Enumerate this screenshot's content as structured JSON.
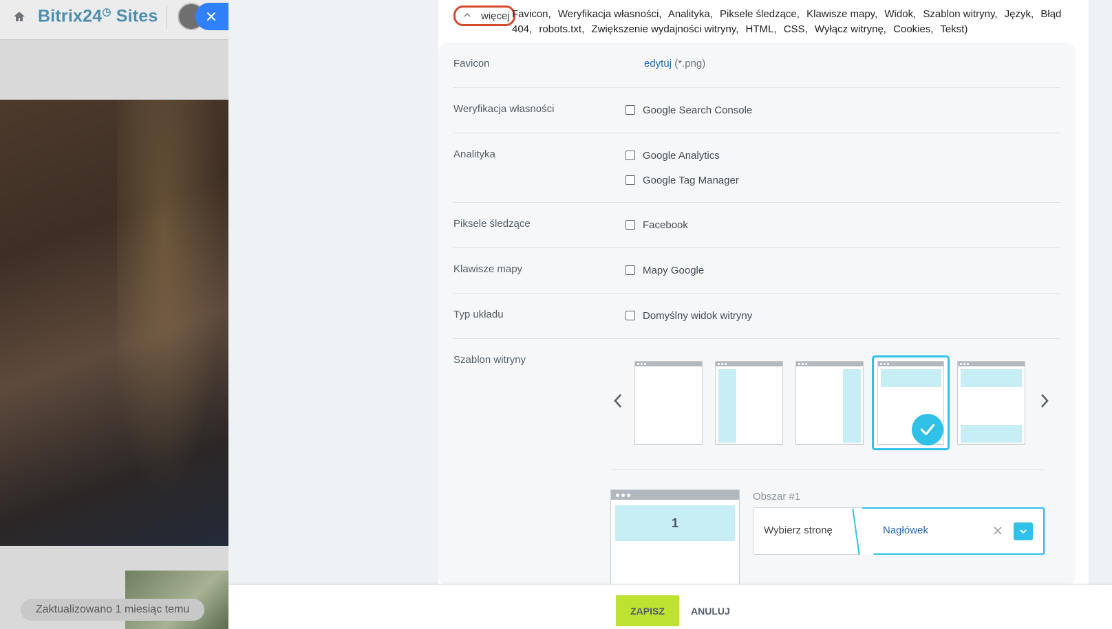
{
  "background_page": {
    "logo_text": "Bitrix24",
    "logo_suffix": "Sites",
    "updated_label": "Zaktualizowano 1 miesiąc temu"
  },
  "more_section": {
    "toggle_label": "więcej",
    "summary_items": [
      "Favicon,",
      "Weryfikacja własności,",
      "Analityka,",
      "Piksele śledzące,",
      "Klawisze mapy,",
      "Widok,",
      "Szablon witryny,",
      "Język,",
      "Błąd 404,",
      "robots.txt,",
      "Zwiększenie wydajności witryny,",
      "HTML,",
      "CSS,",
      "Wyłącz witrynę,",
      "Cookies,",
      "Tekst)"
    ]
  },
  "settings": {
    "favicon": {
      "label": "Favicon",
      "edit_link": "edytuj",
      "hint": "(*.png)"
    },
    "verification": {
      "label": "Weryfikacja własności",
      "options": [
        "Google Search Console"
      ]
    },
    "analytics": {
      "label": "Analityka",
      "options": [
        "Google Analytics",
        "Google Tag Manager"
      ]
    },
    "pixels": {
      "label": "Piksele śledzące",
      "options": [
        "Facebook"
      ]
    },
    "map_keys": {
      "label": "Klawisze mapy",
      "options": [
        "Mapy Google"
      ]
    },
    "layout_type": {
      "label": "Typ układu",
      "options": [
        "Domyślny widok witryny"
      ]
    },
    "site_template": {
      "label": "Szablon witryny",
      "selected_index": 3
    }
  },
  "area": {
    "label": "Obszar #1",
    "zone_number": "1",
    "choose_page": "Wybierz stronę",
    "selected_page": "Nagłówek"
  },
  "footer": {
    "save_label": "ZAPISZ",
    "cancel_label": "ANULUJ"
  },
  "colors": {
    "accent": "#2fc1e8",
    "save_button": "#bde22f",
    "link": "#2067b0",
    "highlight_ring": "#d64a2c",
    "close_button": "#2f80ff"
  }
}
